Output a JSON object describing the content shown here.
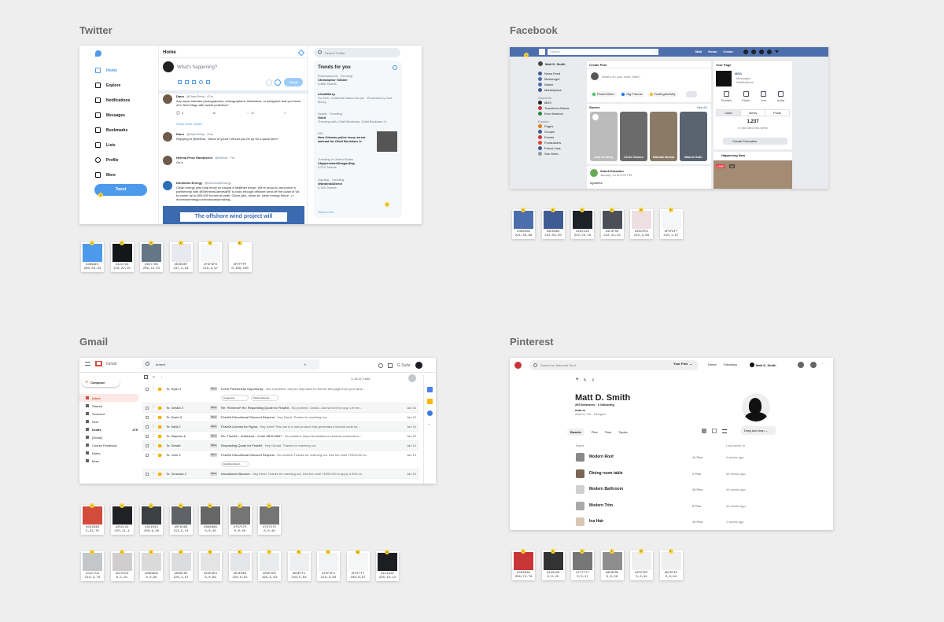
{
  "sections": {
    "twitter": "Twitter",
    "facebook": "Facebook",
    "gmail": "Gmail",
    "pinterest": "Pinterest"
  },
  "twitter": {
    "nav": [
      "Home",
      "Explore",
      "Notifications",
      "Messages",
      "Bookmarks",
      "Lists",
      "Profile",
      "More"
    ],
    "tweet_button": "Tweet",
    "header": "Home",
    "compose_placeholder": "What's happening?",
    "compose_button": "Tweet",
    "search_placeholder": "Search Twitter",
    "trends_title": "Trends for you",
    "tweets": [
      {
        "name": "Dann",
        "handle": "@DannPetty · 47m",
        "text": "Any super talented photographers, videographers, illustrators, or designers that you know of in San Diego with sweet portfolios?",
        "reply": "8",
        "rt": "",
        "like": "10"
      },
      {
        "name": "Dann",
        "handle": "@DannPetty · 29m",
        "text": "Replying to @helena · friend of yours? Would you be up for a quick intro?",
        "reply": "",
        "rt": "",
        "like": ""
      },
      {
        "name": "Helena Price Hambrecht",
        "handle": "@helena · 7m",
        "text": "On it",
        "reply": "",
        "rt": "",
        "like": ""
      },
      {
        "name": "Dominion Energy",
        "handle": "@DominionEnergy",
        "text": "Clean energy jobs help move us toward a healthier future. We're proud to announce a partnership with @SiemensGamesaRE to build enough offshore wind off the coast of VA to power up to 650,000 homes at peak. Clean jobs, clean air, clean energy future. >> dominionenergy.com/company/making...",
        "reply": "",
        "rt": "",
        "like": ""
      }
    ],
    "show_more_replies": "Show more replies",
    "promo_banner": "The offshore wind project will",
    "trends": [
      {
        "meta": "Entertainment · Trending",
        "name": "Christopher Tolkien",
        "count": "6,888 Tweets"
      },
      {
        "meta": "",
        "name": "#JustMercy",
        "count": "On MLK, Celebrate Black Heroes · Promoted by Just Mercy"
      },
      {
        "meta": "Sports · Trending",
        "name": "Odell",
        "count": "Trending with: Odell Beckham, Odell Beckham Jr."
      },
      {
        "meta": "NFL",
        "name": "New Orleans police issue arrest warrant for Odell Beckham Jr.",
        "count": ""
      },
      {
        "meta": "Trending in United States",
        "name": "#AppreciateADragonDay",
        "count": "5,970 Tweets"
      },
      {
        "meta": "Gaming · Trending",
        "name": "#NintendoDirect",
        "count": "5,363 Tweets"
      }
    ],
    "show_more": "Show more",
    "swatches": [
      {
        "color": "#4D9AEC",
        "hex": "#4D9AEC",
        "hsl": "260,50,93"
      },
      {
        "color": "#14171A",
        "hex": "#14171A",
        "hsl": "210,22,10"
      },
      {
        "color": "#657786",
        "hex": "#657786",
        "hsl": "206,22,52"
      },
      {
        "color": "#E8E9EF",
        "hex": "#E8E9EF",
        "hsl": "237,4,94"
      },
      {
        "color": "#F4F6F8",
        "hex": "#F4F6F8",
        "hsl": "210,2,97"
      },
      {
        "color": "#FFFFFF",
        "hex": "#FFFFFF",
        "hsl": "0,100,100"
      }
    ]
  },
  "facebook": {
    "search": "Search",
    "top_links": [
      "Matt",
      "Home",
      "Create"
    ],
    "left_user": "Matt D. Smith",
    "left_items": [
      "News Feed",
      "Messenger",
      "Watch",
      "Marketplace"
    ],
    "shortcuts_title": "Shortcuts",
    "shortcuts": [
      "MDS",
      "Transform Athens",
      "Kinz Warriors"
    ],
    "explore_title": "Explore",
    "explore": [
      "Pages",
      "Groups",
      "Events",
      "Fundraisers",
      "Friend Lists",
      "See More..."
    ],
    "create_post": "Create Post",
    "composer_placeholder": "What's on your mind, Matt?",
    "post_actions": [
      "Photo/Video",
      "Tag Friends",
      "Feeling/Activity"
    ],
    "stories_title": "Stories",
    "see_all": "See All",
    "stories": [
      "Add to Story",
      "Chris Owens",
      "Damian Borba",
      "Marcie Suih"
    ],
    "post_author": "Sobek Emanian",
    "post_meta": "January 14 at 8:00 PM",
    "post_tag": "#grateful",
    "page_title": "Your Page",
    "page_name": "MDS",
    "page_sub": [
      "Messages",
      "Notifications"
    ],
    "page_actions": [
      "Publish",
      "Photo",
      "Live",
      "Invite"
    ],
    "page_tabs": [
      "Likes",
      "Views",
      "Posts"
    ],
    "likes_count": "1,237",
    "likes_sub": "0 new likes this week",
    "promo_button": "Create Promotion",
    "happening": "Happening Now",
    "live_badge": "LIVE",
    "viewers": "1K",
    "swatches": [
      {
        "color": "#4D6EAD",
        "hex": "#4D6EAD",
        "hsl": "221,38,68"
      },
      {
        "color": "#3E5B94",
        "hex": "#3E5B94",
        "hsl": "222,58,50"
      },
      {
        "color": "#1D2128",
        "hex": "#1D2128",
        "hsl": "222,25,16"
      },
      {
        "color": "#4C4F58",
        "hex": "#4C4F58",
        "hsl": "222,12,34"
      },
      {
        "color": "#EEDFE2",
        "hex": "#EEDFE2",
        "hsl": "225,3,89"
      },
      {
        "color": "#F5F6F7",
        "hex": "#F5F6F7",
        "hsl": "210,1,97"
      }
    ]
  },
  "gmail": {
    "app": "Gmail",
    "search_value": "in:sent",
    "suite": "G Suite",
    "compose": "Compose",
    "nav": [
      {
        "label": "Inbox",
        "count": ""
      },
      {
        "label": "Starred",
        "count": ""
      },
      {
        "label": "Snoozed",
        "count": ""
      },
      {
        "label": "Sent",
        "count": ""
      },
      {
        "label": "Drafts",
        "count": "275"
      },
      {
        "label": "[Gmail]",
        "count": ""
      },
      {
        "label": "Course Feedback",
        "count": ""
      },
      {
        "label": "Notes",
        "count": ""
      },
      {
        "label": "More",
        "count": ""
      }
    ],
    "pagination": "1–50 of 3,846",
    "emails": [
      {
        "to": "To: Ryan 4",
        "subject": "Event Partnership Opportunity",
        "snippet": " - Not a problem, but you may want to remove this page from your deck...",
        "date": "",
        "attachments": [
          "image.png",
          "Partnership-De..."
        ]
      },
      {
        "to": "To: Gerald 3",
        "subject": "Re: *External*-Re: Requesting Quote for FlowKit",
        "snippet": " - No problem, Gerald. Just send it my way. Let me...",
        "date": "Jan 15",
        "attachments": []
      },
      {
        "to": "To: David 3",
        "subject": "FlowKit Educational Discount Request",
        "snippet": " - Hey David, Thanks for reaching out.",
        "date": "Jan 15",
        "attachments": []
      },
      {
        "to": "To: Sahil 2",
        "subject": "FlowKit License for Figma",
        "snippet": " - Hey Sahil! This one is a new product that generates a license code for...",
        "date": "Jan 15",
        "attachments": []
      },
      {
        "to": "To: Mauricio 6",
        "subject": "Re: FlowKit – Individual – Order MDS15667",
        "snippet": " - No problem: https://transactions.sendowl.com/orders/...",
        "date": "Jan 15",
        "attachments": []
      },
      {
        "to": "To: Gerald",
        "subject": "Requesting Quote for FlowKit",
        "snippet": " - Hey Gerald, Thanks for reaching out.",
        "date": "Jan 14",
        "attachments": []
      },
      {
        "to": "To: John 3",
        "subject": "FlowKit Educational Discount Request",
        "snippet": " - No worries! Thanks for reaching out. Use the code FKEDU30 to...",
        "date": "Jan 13",
        "attachments": [
          "EnrollmentCerti..."
        ]
      },
      {
        "to": "To: Cimaoua 2",
        "subject": "educational discount",
        "snippet": " - Hey there! Thanks for reaching out. Use the code FKEDU30 to apply a 50% of...",
        "date": "Jan 13",
        "attachments": []
      }
    ],
    "inbox_label": "Inbox",
    "swatches_row1": [
      {
        "color": "#D24B3B",
        "hex": "#D24B3B",
        "hsl": "5,63,70"
      },
      {
        "color": "#202124",
        "hex": "#202124",
        "hsl": "225,11,4"
      },
      {
        "color": "#3C4043",
        "hex": "#3C4043",
        "hsl": "206,6,26"
      },
      {
        "color": "#5F6368",
        "hex": "#5F6368",
        "hsl": "213,5,41"
      },
      {
        "color": "#666666",
        "hex": "#666666",
        "hsl": "0,0,40"
      },
      {
        "color": "#757575",
        "hex": "#757575",
        "hsl": "0,0,46"
      },
      {
        "color": "#757575",
        "hex": "#757575",
        "hsl": "0,0,46"
      }
    ],
    "swatches_row2": [
      {
        "color": "#C4C7CA",
        "hex": "#C4C7CA",
        "hsl": "210,3,79"
      },
      {
        "color": "#CFCDCD",
        "hex": "#CFCDCD",
        "hsl": "0,1,81"
      },
      {
        "color": "#DADADA",
        "hex": "#DADADA",
        "hsl": "0,0,85"
      },
      {
        "color": "#DBDCDE",
        "hex": "#DBDCDE",
        "hsl": "220,2,87"
      },
      {
        "color": "#E4E4E4",
        "hex": "#E4E4E4",
        "hsl": "0,0,89"
      },
      {
        "color": "#E4E6EA",
        "hex": "#E4E6EA",
        "hsl": "220,9,92"
      },
      {
        "color": "#E9ECED",
        "hex": "#E9ECED",
        "hsl": "195,5,93"
      },
      {
        "color": "#EDEFF1",
        "hex": "#EDEFF1",
        "hsl": "210,5,94"
      },
      {
        "color": "#F2F3F4",
        "hex": "#F2F3F4",
        "hsl": "210,3,96"
      },
      {
        "color": "#F5F7F7",
        "hex": "#F5F7F7",
        "hsl": "180,8,97"
      },
      {
        "color": "#1C1E22",
        "hex": "#1C1E22",
        "hsl": "220,10,12"
      }
    ]
  },
  "pinterest": {
    "search_placeholder": "Search for Mansard Roof",
    "your_pins": "Your Pins",
    "nav": [
      "Home",
      "Following"
    ],
    "user": "Matt D. Smith",
    "profile_name": "Matt D. Smith",
    "followers": "265 followers · 6 following",
    "site": "mds.is",
    "location": "Athens, GA · Designer",
    "tabs": [
      "Boards",
      "Pins",
      "Tries",
      "Topics"
    ],
    "sort_button": "Drag and drop",
    "col_name": "Name",
    "col_saved": "Last saved to",
    "boards": [
      {
        "name": "Modern Roof",
        "pins": "14 Pins",
        "saved": "4 weeks ago"
      },
      {
        "name": "Dining room table",
        "pins": "2 Pins",
        "saved": "35 weeks ago"
      },
      {
        "name": "Modern Bathroom",
        "pins": "20 Pins",
        "saved": "40 weeks ago"
      },
      {
        "name": "Modern Trim",
        "pins": "6 Pins",
        "saved": "42 weeks ago"
      },
      {
        "name": "Ina Hair",
        "pins": "10 Pins",
        "saved": "2 weeks ago"
      }
    ],
    "swatches": [
      {
        "color": "#C83638",
        "hex": "#C83638",
        "hsl": "359,73,78"
      },
      {
        "color": "#333333",
        "hex": "#333333",
        "hsl": "0,0,20"
      },
      {
        "color": "#777777",
        "hex": "#777777",
        "hsl": "0,0,47"
      },
      {
        "color": "#8E8E8E",
        "hex": "#8E8E8E",
        "hsl": "0,0,56"
      },
      {
        "color": "#EFEFEF",
        "hex": "#EFEFEF",
        "hsl": "0,0,94"
      },
      {
        "color": "#EFEFEF",
        "hex": "#EFEFEF",
        "hsl": "0,0,94"
      }
    ]
  }
}
